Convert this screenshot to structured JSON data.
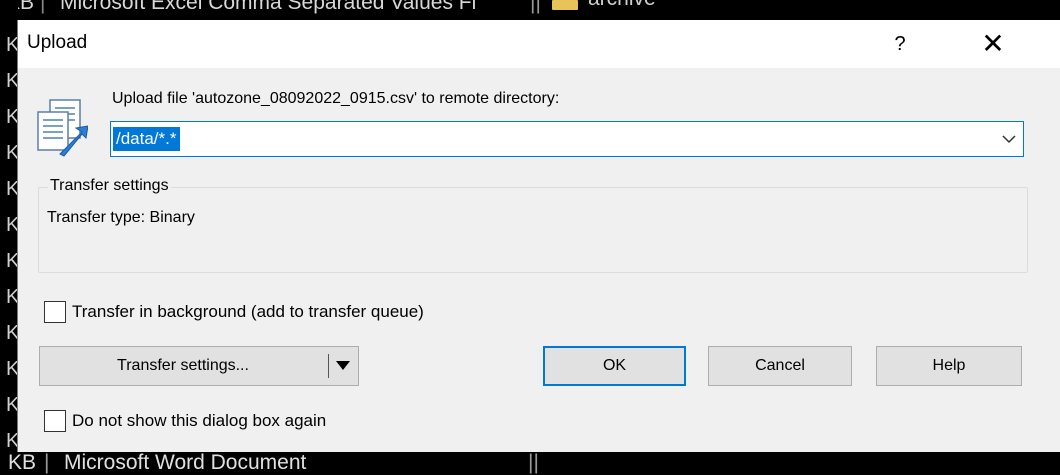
{
  "background": {
    "top_row": {
      "size": "KB",
      "type": "Microsoft Excel Comma Separated Values Fi",
      "folder": "archive"
    },
    "left_letters": [
      "K",
      "K",
      "K",
      "K",
      "K",
      "K",
      "K",
      "K",
      "K",
      "K",
      "K",
      "K",
      "K"
    ],
    "bottom_row": {
      "size": "KB",
      "type": "Microsoft Word Document"
    }
  },
  "dialog": {
    "title": "Upload",
    "help_symbol": "?",
    "close_symbol": "✕",
    "prompt": "Upload file 'autozone_08092022_0915.csv' to remote directory:",
    "remote_directory": "/data/*.*",
    "transfer_group": {
      "legend": "Transfer settings",
      "transfer_type": "Transfer type: Binary"
    },
    "background_checkbox": {
      "label": "Transfer in background (add to transfer queue)",
      "checked": false
    },
    "buttons": {
      "transfer_settings": "Transfer settings...",
      "ok": "OK",
      "cancel": "Cancel",
      "help": "Help"
    },
    "dont_show_checkbox": {
      "label": "Do not show this dialog box again",
      "checked": false
    }
  },
  "colors": {
    "accent": "#0078d7",
    "dialog_bg": "#f0f0f0",
    "button_bg": "#e1e1e1"
  },
  "icons": {
    "upload": "upload-document-icon",
    "dropdown": "chevron-down-icon",
    "split": "triangle-down-icon"
  }
}
